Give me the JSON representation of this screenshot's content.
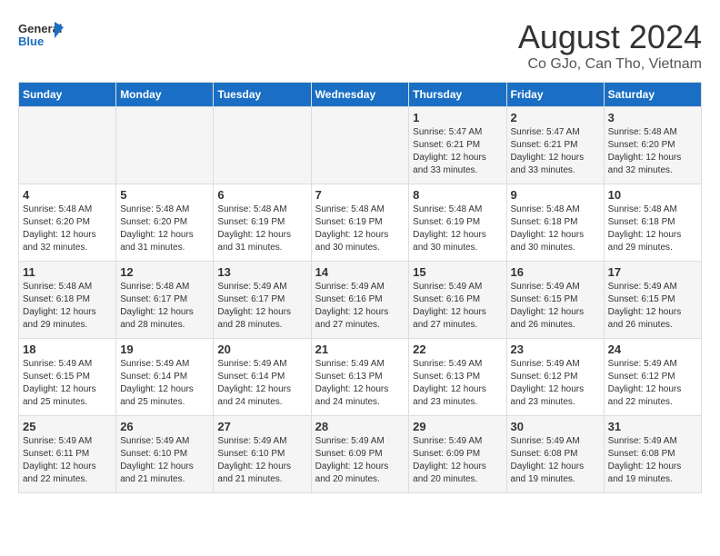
{
  "header": {
    "logo_line1": "General",
    "logo_line2": "Blue",
    "title": "August 2024",
    "subtitle": "Co GJo, Can Tho, Vietnam"
  },
  "days_of_week": [
    "Sunday",
    "Monday",
    "Tuesday",
    "Wednesday",
    "Thursday",
    "Friday",
    "Saturday"
  ],
  "weeks": [
    [
      {
        "day": "",
        "info": ""
      },
      {
        "day": "",
        "info": ""
      },
      {
        "day": "",
        "info": ""
      },
      {
        "day": "",
        "info": ""
      },
      {
        "day": "1",
        "info": "Sunrise: 5:47 AM\nSunset: 6:21 PM\nDaylight: 12 hours\nand 33 minutes."
      },
      {
        "day": "2",
        "info": "Sunrise: 5:47 AM\nSunset: 6:21 PM\nDaylight: 12 hours\nand 33 minutes."
      },
      {
        "day": "3",
        "info": "Sunrise: 5:48 AM\nSunset: 6:20 PM\nDaylight: 12 hours\nand 32 minutes."
      }
    ],
    [
      {
        "day": "4",
        "info": "Sunrise: 5:48 AM\nSunset: 6:20 PM\nDaylight: 12 hours\nand 32 minutes."
      },
      {
        "day": "5",
        "info": "Sunrise: 5:48 AM\nSunset: 6:20 PM\nDaylight: 12 hours\nand 31 minutes."
      },
      {
        "day": "6",
        "info": "Sunrise: 5:48 AM\nSunset: 6:19 PM\nDaylight: 12 hours\nand 31 minutes."
      },
      {
        "day": "7",
        "info": "Sunrise: 5:48 AM\nSunset: 6:19 PM\nDaylight: 12 hours\nand 30 minutes."
      },
      {
        "day": "8",
        "info": "Sunrise: 5:48 AM\nSunset: 6:19 PM\nDaylight: 12 hours\nand 30 minutes."
      },
      {
        "day": "9",
        "info": "Sunrise: 5:48 AM\nSunset: 6:18 PM\nDaylight: 12 hours\nand 30 minutes."
      },
      {
        "day": "10",
        "info": "Sunrise: 5:48 AM\nSunset: 6:18 PM\nDaylight: 12 hours\nand 29 minutes."
      }
    ],
    [
      {
        "day": "11",
        "info": "Sunrise: 5:48 AM\nSunset: 6:18 PM\nDaylight: 12 hours\nand 29 minutes."
      },
      {
        "day": "12",
        "info": "Sunrise: 5:48 AM\nSunset: 6:17 PM\nDaylight: 12 hours\nand 28 minutes."
      },
      {
        "day": "13",
        "info": "Sunrise: 5:49 AM\nSunset: 6:17 PM\nDaylight: 12 hours\nand 28 minutes."
      },
      {
        "day": "14",
        "info": "Sunrise: 5:49 AM\nSunset: 6:16 PM\nDaylight: 12 hours\nand 27 minutes."
      },
      {
        "day": "15",
        "info": "Sunrise: 5:49 AM\nSunset: 6:16 PM\nDaylight: 12 hours\nand 27 minutes."
      },
      {
        "day": "16",
        "info": "Sunrise: 5:49 AM\nSunset: 6:15 PM\nDaylight: 12 hours\nand 26 minutes."
      },
      {
        "day": "17",
        "info": "Sunrise: 5:49 AM\nSunset: 6:15 PM\nDaylight: 12 hours\nand 26 minutes."
      }
    ],
    [
      {
        "day": "18",
        "info": "Sunrise: 5:49 AM\nSunset: 6:15 PM\nDaylight: 12 hours\nand 25 minutes."
      },
      {
        "day": "19",
        "info": "Sunrise: 5:49 AM\nSunset: 6:14 PM\nDaylight: 12 hours\nand 25 minutes."
      },
      {
        "day": "20",
        "info": "Sunrise: 5:49 AM\nSunset: 6:14 PM\nDaylight: 12 hours\nand 24 minutes."
      },
      {
        "day": "21",
        "info": "Sunrise: 5:49 AM\nSunset: 6:13 PM\nDaylight: 12 hours\nand 24 minutes."
      },
      {
        "day": "22",
        "info": "Sunrise: 5:49 AM\nSunset: 6:13 PM\nDaylight: 12 hours\nand 23 minutes."
      },
      {
        "day": "23",
        "info": "Sunrise: 5:49 AM\nSunset: 6:12 PM\nDaylight: 12 hours\nand 23 minutes."
      },
      {
        "day": "24",
        "info": "Sunrise: 5:49 AM\nSunset: 6:12 PM\nDaylight: 12 hours\nand 22 minutes."
      }
    ],
    [
      {
        "day": "25",
        "info": "Sunrise: 5:49 AM\nSunset: 6:11 PM\nDaylight: 12 hours\nand 22 minutes."
      },
      {
        "day": "26",
        "info": "Sunrise: 5:49 AM\nSunset: 6:10 PM\nDaylight: 12 hours\nand 21 minutes."
      },
      {
        "day": "27",
        "info": "Sunrise: 5:49 AM\nSunset: 6:10 PM\nDaylight: 12 hours\nand 21 minutes."
      },
      {
        "day": "28",
        "info": "Sunrise: 5:49 AM\nSunset: 6:09 PM\nDaylight: 12 hours\nand 20 minutes."
      },
      {
        "day": "29",
        "info": "Sunrise: 5:49 AM\nSunset: 6:09 PM\nDaylight: 12 hours\nand 20 minutes."
      },
      {
        "day": "30",
        "info": "Sunrise: 5:49 AM\nSunset: 6:08 PM\nDaylight: 12 hours\nand 19 minutes."
      },
      {
        "day": "31",
        "info": "Sunrise: 5:49 AM\nSunset: 6:08 PM\nDaylight: 12 hours\nand 19 minutes."
      }
    ]
  ]
}
